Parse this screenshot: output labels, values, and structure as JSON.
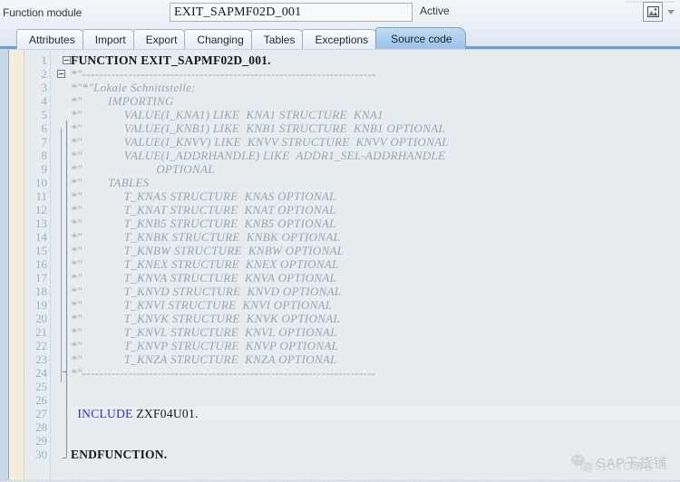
{
  "header": {
    "label": "Function module",
    "function_name": "EXIT_SAPMF02D_001",
    "status": "Active",
    "picture_icon": "picture-icon",
    "dropdown_icon": "chevron-down-icon"
  },
  "tabs": [
    {
      "label": "Attributes",
      "active": false
    },
    {
      "label": "Import",
      "active": false
    },
    {
      "label": "Export",
      "active": false
    },
    {
      "label": "Changing",
      "active": false
    },
    {
      "label": "Tables",
      "active": false
    },
    {
      "label": "Exceptions",
      "active": false
    },
    {
      "label": "Source code",
      "active": true
    }
  ],
  "editor": {
    "line_count": 30,
    "highlighted_line": 27,
    "colors": {
      "background": "#e7ecf0",
      "line_number": "#8fb9bf",
      "comment": "#9aa6af",
      "keyword": "#16181a",
      "include_keyword": "#2d2df0",
      "accent": "#6d9fd4",
      "rail_blue": "#c8d9ec",
      "rail_cream": "#f3edda"
    },
    "lines": [
      {
        "n": 1,
        "segments": [
          {
            "t": "FUNCTION ",
            "k": "kw"
          },
          {
            "t": "EXIT_SAPMF02D_001.",
            "k": "kw"
          }
        ]
      },
      {
        "n": 2,
        "segments": [
          {
            "t": "*\"----------------------------------------------------------------------",
            "k": "cmt"
          }
        ]
      },
      {
        "n": 3,
        "segments": [
          {
            "t": "*\"*\"Lokale Schnittstelle:",
            "k": "cmt"
          }
        ]
      },
      {
        "n": 4,
        "segments": [
          {
            "t": "*\"        IMPORTING",
            "k": "cmt"
          }
        ]
      },
      {
        "n": 5,
        "segments": [
          {
            "t": "*\"             VALUE(I_KNA1) LIKE  KNA1 STRUCTURE  KNA1",
            "k": "cmt"
          }
        ]
      },
      {
        "n": 6,
        "segments": [
          {
            "t": "*\"             VALUE(I_KNB1) LIKE  KNB1 STRUCTURE  KNB1 OPTIONAL",
            "k": "cmt"
          }
        ]
      },
      {
        "n": 7,
        "segments": [
          {
            "t": "*\"             VALUE(I_KNVV) LIKE  KNVV STRUCTURE  KNVV OPTIONAL",
            "k": "cmt"
          }
        ]
      },
      {
        "n": 8,
        "segments": [
          {
            "t": "*\"             VALUE(I_ADDRHANDLE) LIKE  ADDR1_SEL-ADDRHANDLE",
            "k": "cmt"
          }
        ]
      },
      {
        "n": 9,
        "segments": [
          {
            "t": "*\"                       OPTIONAL",
            "k": "cmt"
          }
        ]
      },
      {
        "n": 10,
        "segments": [
          {
            "t": "*\"        TABLES",
            "k": "cmt"
          }
        ]
      },
      {
        "n": 11,
        "segments": [
          {
            "t": "*\"             T_KNAS STRUCTURE  KNAS OPTIONAL",
            "k": "cmt"
          }
        ]
      },
      {
        "n": 12,
        "segments": [
          {
            "t": "*\"             T_KNAT STRUCTURE  KNAT OPTIONAL",
            "k": "cmt"
          }
        ]
      },
      {
        "n": 13,
        "segments": [
          {
            "t": "*\"             T_KNB5 STRUCTURE  KNB5 OPTIONAL",
            "k": "cmt"
          }
        ]
      },
      {
        "n": 14,
        "segments": [
          {
            "t": "*\"             T_KNBK STRUCTURE  KNBK OPTIONAL",
            "k": "cmt"
          }
        ]
      },
      {
        "n": 15,
        "segments": [
          {
            "t": "*\"             T_KNBW STRUCTURE  KNBW OPTIONAL",
            "k": "cmt"
          }
        ]
      },
      {
        "n": 16,
        "segments": [
          {
            "t": "*\"             T_KNEX STRUCTURE  KNEX OPTIONAL",
            "k": "cmt"
          }
        ]
      },
      {
        "n": 17,
        "segments": [
          {
            "t": "*\"             T_KNVA STRUCTURE  KNVA OPTIONAL",
            "k": "cmt"
          }
        ]
      },
      {
        "n": 18,
        "segments": [
          {
            "t": "*\"             T_KNVD STRUCTURE  KNVD OPTIONAL",
            "k": "cmt"
          }
        ]
      },
      {
        "n": 19,
        "segments": [
          {
            "t": "*\"             T_KNVI STRUCTURE  KNVI OPTIONAL",
            "k": "cmt"
          }
        ]
      },
      {
        "n": 20,
        "segments": [
          {
            "t": "*\"             T_KNVK STRUCTURE  KNVK OPTIONAL",
            "k": "cmt"
          }
        ]
      },
      {
        "n": 21,
        "segments": [
          {
            "t": "*\"             T_KNVL STRUCTURE  KNVL OPTIONAL",
            "k": "cmt"
          }
        ]
      },
      {
        "n": 22,
        "segments": [
          {
            "t": "*\"             T_KNVP STRUCTURE  KNVP OPTIONAL",
            "k": "cmt"
          }
        ]
      },
      {
        "n": 23,
        "segments": [
          {
            "t": "*\"             T_KNZA STRUCTURE  KNZA OPTIONAL",
            "k": "cmt"
          }
        ]
      },
      {
        "n": 24,
        "segments": [
          {
            "t": "*\"----------------------------------------------------------------------",
            "k": "cmt"
          }
        ]
      },
      {
        "n": 25,
        "segments": []
      },
      {
        "n": 26,
        "segments": []
      },
      {
        "n": 27,
        "segments": [
          {
            "t": "  INCLUDE ",
            "k": "inc"
          },
          {
            "t": "ZXF04U01.",
            "k": "incarg"
          }
        ]
      },
      {
        "n": 28,
        "segments": []
      },
      {
        "n": 29,
        "segments": []
      },
      {
        "n": 30,
        "segments": [
          {
            "t": "ENDFUNCTION.",
            "k": "kw"
          }
        ]
      }
    ]
  },
  "watermark": {
    "icon": "wechat-icon",
    "text": "SAP干货铺",
    "subtext": "@51CTO博客"
  }
}
